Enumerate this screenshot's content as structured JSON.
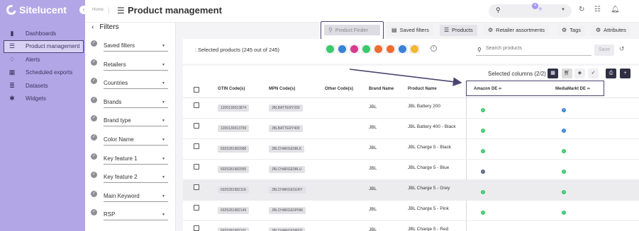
{
  "app": {
    "name": "Sitelucent"
  },
  "sidebar": {
    "items": [
      {
        "label": "Dashboards",
        "icon": "bar-chart-icon"
      },
      {
        "label": "Product management",
        "icon": "list-icon",
        "active": true
      },
      {
        "label": "Alerts",
        "icon": "alert-icon"
      },
      {
        "label": "Scheduled exports",
        "icon": "calendar-icon"
      },
      {
        "label": "Datasets",
        "icon": "database-icon"
      },
      {
        "label": "Widgets",
        "icon": "puzzle-icon"
      }
    ]
  },
  "header": {
    "breadcrumb": "Home",
    "title": "Product management",
    "notification_count": "4"
  },
  "filters": {
    "title": "Filters",
    "items": [
      {
        "label": "Saved filters",
        "icon": "saved-filters-icon"
      },
      {
        "label": "Retailers",
        "icon": "cart-icon"
      },
      {
        "label": "Countries",
        "icon": "globe-icon"
      },
      {
        "label": "Brands",
        "icon": "brand-icon"
      },
      {
        "label": "Brand type",
        "icon": "brand-type-icon"
      },
      {
        "label": "Color Name",
        "icon": "check-circle-icon"
      },
      {
        "label": "Key feature 1",
        "icon": "check-circle-icon"
      },
      {
        "label": "Key feature 2",
        "icon": "check-circle-icon"
      },
      {
        "label": "Main Keyword",
        "icon": "check-circle-icon"
      },
      {
        "label": "RSP",
        "icon": "check-circle-icon"
      }
    ]
  },
  "tabs": [
    {
      "label": "Product Finder",
      "icon": "search-icon"
    },
    {
      "label": "Saved filters",
      "icon": "saved-filters-icon"
    },
    {
      "label": "Products",
      "icon": "list-icon"
    },
    {
      "label": "Retailer assortments",
      "icon": "gear-icon"
    },
    {
      "label": "Tags",
      "icon": "gear-icon"
    },
    {
      "label": "Attributes",
      "icon": "gear-icon"
    }
  ],
  "toolbar": {
    "selected_products": "Selected products (245 out of 245)",
    "search_placeholder": "Search products",
    "save_label": "Save",
    "status_chips": [
      {
        "color": "#3cc86c"
      },
      {
        "color": "#3b82d6"
      },
      {
        "color": "#d63b8c"
      },
      {
        "color": "#3cc86c"
      },
      {
        "color": "#f06b2f"
      },
      {
        "color": "#f06b2f"
      },
      {
        "color": "#3b82d6"
      },
      {
        "color": "#f2b82f"
      }
    ]
  },
  "table": {
    "selected_columns": "Selected columns (2/2)",
    "columns": {
      "gtin": "GTIN Code(s)",
      "mpn": "MPN Code(s)",
      "other": "Other Code(s)",
      "brand": "Brand Name",
      "product": "Product Name",
      "amazon": "Amazon DE",
      "mediamarkt": "MediaMarkt DE"
    },
    "rows": [
      {
        "gtin": "1200130013874",
        "mpn": "JBLBATTERY200",
        "brand": "JBL",
        "product": "JBL Battery 200",
        "amazon": "#3cc86c",
        "mediamarkt": "#3b82d6"
      },
      {
        "gtin": "1200130013799",
        "mpn": "JBLBATTERY400",
        "brand": "JBL",
        "product": "JBL Battery 400 - Black",
        "amazon": "#3cc86c",
        "mediamarkt": "#3b82d6"
      },
      {
        "gtin": "6925281982088",
        "mpn": "JBLCHARGE5BLK",
        "brand": "JBL",
        "product": "JBL Charge 5 - Black",
        "amazon": "#3cc86c",
        "mediamarkt": "#3cc86c"
      },
      {
        "gtin": "6925281982095",
        "mpn": "JBLCHARGE5BLU",
        "brand": "JBL",
        "product": "JBL Charge 5 - Blue",
        "amazon": "#5b6380",
        "mediamarkt": "#3cc86c"
      },
      {
        "gtin": "6925281982118",
        "mpn": "JBLCHARGE5GRY",
        "brand": "JBL",
        "product": "JBL Charge 5 - Grey",
        "amazon": "#3cc86c",
        "mediamarkt": "#3cc86c",
        "highlight": true
      },
      {
        "gtin": "6925281982149",
        "mpn": "JBLCHARGE5PINK",
        "brand": "JBL",
        "product": "JBL Charge 5 - Pink",
        "amazon": "#3cc86c",
        "mediamarkt": "#3cc86c"
      },
      {
        "gtin": "6925281982101",
        "mpn": "JBLCHARGE5RED",
        "brand": "JBL",
        "product": "JBL Charge 5 - Red",
        "amazon": "#3cc86c",
        "mediamarkt": "#3cc86c"
      }
    ]
  }
}
